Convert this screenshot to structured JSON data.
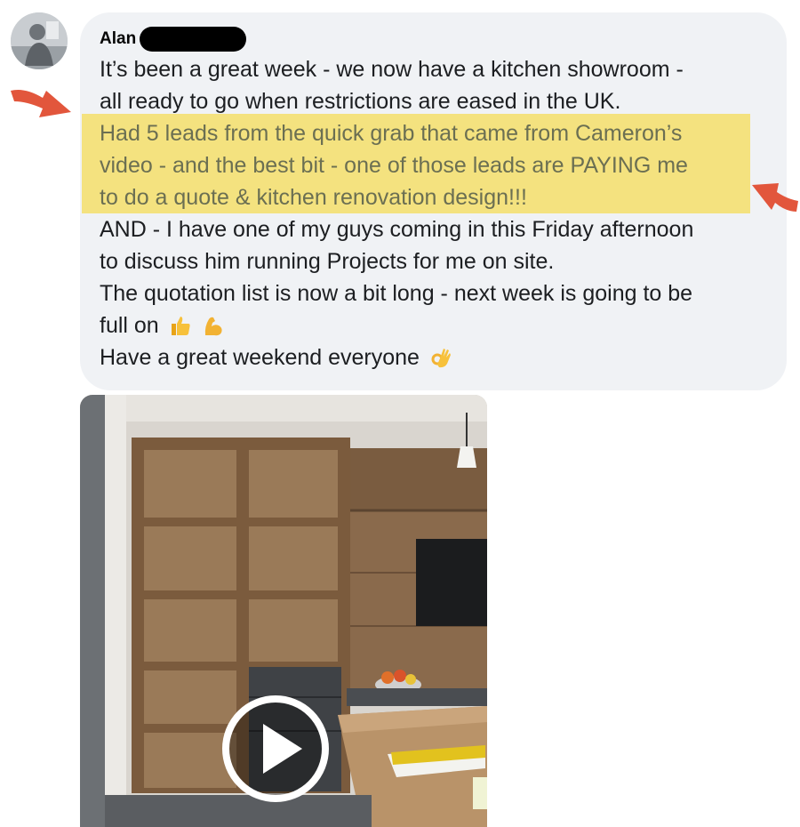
{
  "post": {
    "author": "Alan",
    "lines": [
      "It’s been a great week - we now have a kitchen showroom -",
      "all ready to go when restrictions are eased in the UK.",
      "Had 5 leads from the quick grab that came from Cameron’s",
      "video - and the best bit - one of those leads are PAYING me",
      "to do a quote & kitchen renovation design!!!",
      "AND - I have one of my guys coming in this Friday afternoon",
      "to discuss him running Projects for me on site.",
      "The quotation list is now a bit long - next week is going to be",
      "full on",
      "Have a great weekend everyone"
    ],
    "emojis": [
      "thumbs-up-icon",
      "flexed-biceps-icon",
      "ok-hand-icon"
    ]
  },
  "colors": {
    "highlight": "#f5df6a",
    "arrow": "#e2563c",
    "bubble": "#f0f2f5"
  },
  "media": {
    "type": "video",
    "icon": "play-icon"
  }
}
